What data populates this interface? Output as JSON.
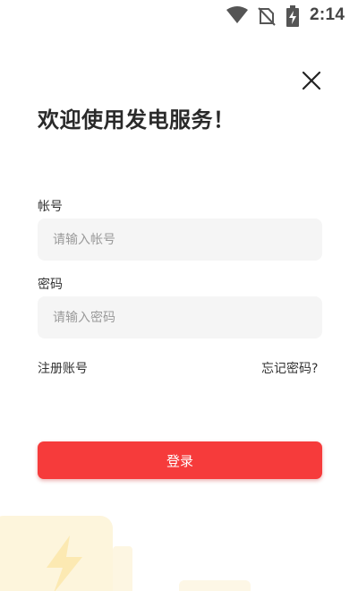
{
  "status_bar": {
    "time": "2:14",
    "icons": [
      "wifi-icon",
      "no-sim-icon",
      "battery-charging-icon"
    ]
  },
  "header": {
    "close_icon": "close-icon",
    "title": "欢迎使用发电服务！"
  },
  "form": {
    "account_label": "帐号",
    "account_placeholder": "请输入帐号",
    "account_value": "",
    "password_label": "密码",
    "password_placeholder": "请输入密码",
    "password_value": ""
  },
  "links": {
    "register": "注册账号",
    "forgot_password": "忘记密码?"
  },
  "login_button": "登录",
  "colors": {
    "primary": "#f63b3b",
    "input_bg": "#f5f5f5",
    "decor": "#fdf3d4"
  }
}
